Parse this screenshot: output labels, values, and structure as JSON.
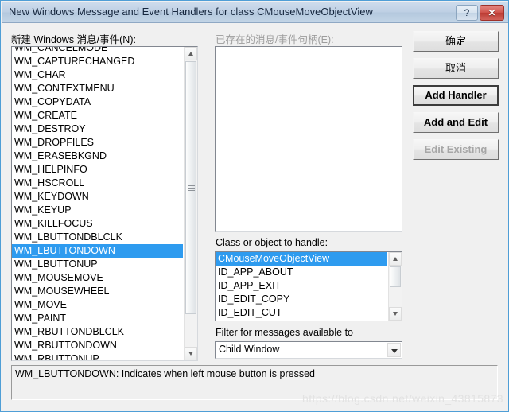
{
  "window": {
    "title": "New Windows Message and Event Handlers for class CMouseMoveObjectView",
    "help_button": "?",
    "close_button": "✕",
    "accent_border": "#4f9ed6",
    "titlebar_color": "#bed0e4",
    "dialog_background": "#f0f0f0",
    "selection_color": "#2e9bef"
  },
  "new_messages": {
    "label": "新建 Windows 消息/事件(N):",
    "selected": "WM_LBUTTONDOWN",
    "items": [
      "WM_CANCELMODE",
      "WM_CAPTURECHANGED",
      "WM_CHAR",
      "WM_CONTEXTMENU",
      "WM_COPYDATA",
      "WM_CREATE",
      "WM_DESTROY",
      "WM_DROPFILES",
      "WM_ERASEBKGND",
      "WM_HELPINFO",
      "WM_HSCROLL",
      "WM_KEYDOWN",
      "WM_KEYUP",
      "WM_KILLFOCUS",
      "WM_LBUTTONDBLCLK",
      "WM_LBUTTONDOWN",
      "WM_LBUTTONUP",
      "WM_MOUSEMOVE",
      "WM_MOUSEWHEEL",
      "WM_MOVE",
      "WM_PAINT",
      "WM_RBUTTONDBLCLK",
      "WM_RBUTTONDOWN",
      "WM_RBUTTONUP"
    ]
  },
  "existing_handlers": {
    "label": "已存在的消息/事件句柄(E):",
    "disabled": true,
    "items": []
  },
  "class_list": {
    "label": "Class or object to handle:",
    "selected": "CMouseMoveObjectView",
    "items": [
      "CMouseMoveObjectView",
      "ID_APP_ABOUT",
      "ID_APP_EXIT",
      "ID_EDIT_COPY",
      "ID_EDIT_CUT"
    ]
  },
  "filter": {
    "label": "Filter for messages available to",
    "value": "Child Window",
    "options": [
      "Child Window"
    ]
  },
  "buttons": [
    {
      "id": "ok",
      "label": "确定",
      "style": "normal",
      "enabled": true
    },
    {
      "id": "cancel",
      "label": "取消",
      "style": "normal",
      "enabled": true
    },
    {
      "id": "add-handler",
      "label": "Add Handler",
      "style": "default",
      "enabled": true
    },
    {
      "id": "add-and-edit",
      "label": "Add and Edit",
      "style": "bold",
      "enabled": true
    },
    {
      "id": "edit-existing",
      "label": "Edit Existing",
      "style": "bold",
      "enabled": false
    }
  ],
  "description": {
    "text": "WM_LBUTTONDOWN:  Indicates when left mouse button is pressed"
  },
  "watermark": {
    "text": "https://blog.csdn.net/weixin_43815873"
  }
}
